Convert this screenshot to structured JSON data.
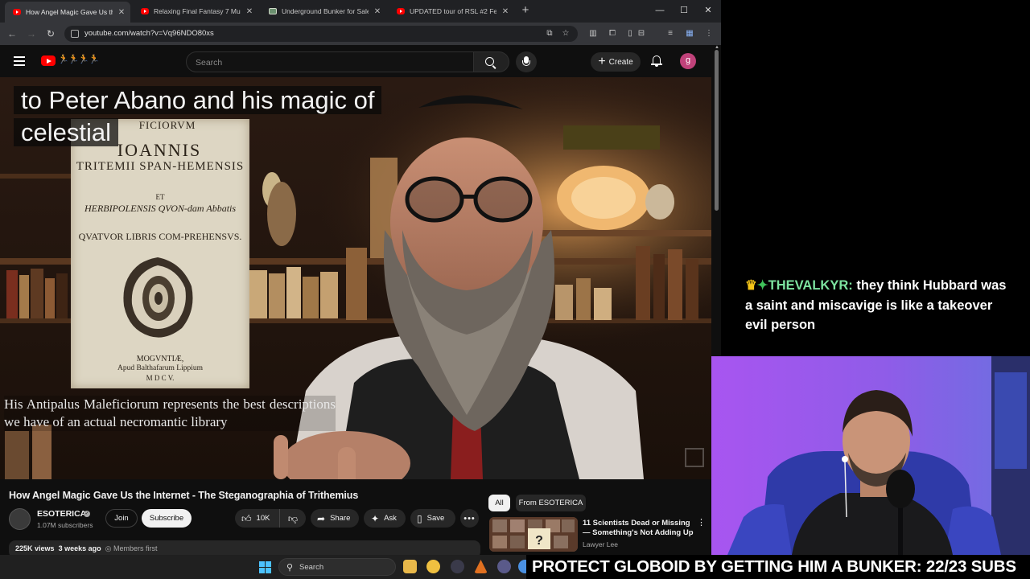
{
  "browser": {
    "tabs": [
      {
        "title": "How Angel Magic Gave Us the",
        "type": "youtube",
        "active": true
      },
      {
        "title": "Relaxing Final Fantasy 7 Music",
        "type": "youtube",
        "active": false
      },
      {
        "title": "Underground Bunker for Sale -",
        "type": "image",
        "active": false
      },
      {
        "title": "UPDATED tour of RSL #2 Februa",
        "type": "youtube",
        "active": false
      }
    ],
    "url": "youtube.com/watch?v=Vq96NDO80xs"
  },
  "youtube": {
    "search_placeholder": "Search",
    "create_label": "Create",
    "avatar_letter": "g",
    "logo_figures": "🏃🏃🏃🏃"
  },
  "video": {
    "caption_top_line1": "to Peter Abano and his magic of",
    "caption_top_line2": "celestial",
    "caption_bottom": "His Antipalus Maleficiorum represents the best descriptions we have of an actual necromantic library",
    "book": {
      "l1": "FICIORVM",
      "l2": "IOANNIS",
      "l3": "TRITEMII SPAN-HEMENSIS",
      "l4": "ET",
      "l5": "HERBIPOLENSIS QVON-dam Abbatis",
      "l6": "QVATVOR LIBRIS COM-PREHENSVS.",
      "l7": "MOGVNTIÆ,",
      "l8": "Apud Balthafarum Lippium",
      "l9": "M D C V."
    }
  },
  "below": {
    "title": "How Angel Magic Gave Us the Internet - The Steganographia of Trithemius",
    "channel": "ESOTERICA",
    "subscribers": "1.07M subscribers",
    "join": "Join",
    "subscribe": "Subscribe",
    "likes": "10K",
    "share": "Share",
    "ask": "Ask",
    "save": "Save",
    "views": "225K views",
    "age": "3 weeks ago",
    "members": "Members first",
    "chips": [
      "All",
      "From ESOTERICA"
    ],
    "rec_title": "11 Scientists Dead or Missing — Something's Not Adding Up",
    "rec_channel": "Lawyer Lee"
  },
  "chat": {
    "username": "THEVALKYR:",
    "message": "they think Hubbard was a saint and miscavige is like a takeover evil person"
  },
  "taskbar": {
    "search_label": "Search"
  },
  "banner": {
    "text": "PROTECT GLOBOID BY GETTING HIM A BUNKER: 22/23 SUBS"
  },
  "colors": {
    "yt_red": "#ff0000",
    "chat_user": "#7de3a0",
    "webcam_bg": "#b35ee8"
  }
}
